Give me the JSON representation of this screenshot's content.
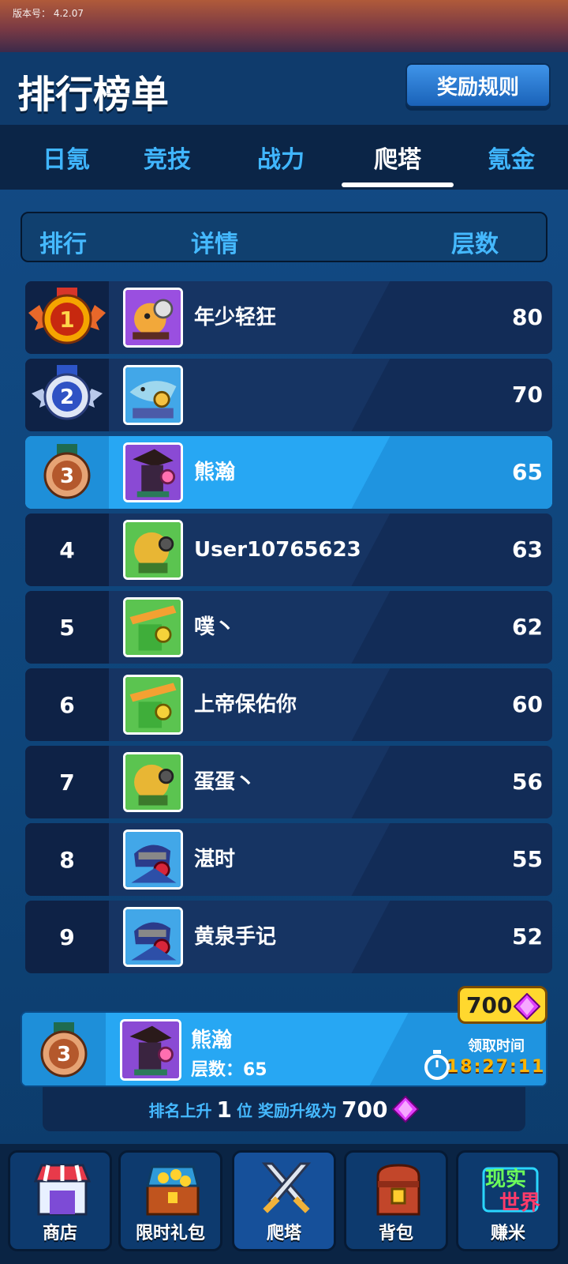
{
  "version": {
    "label": "版本号：",
    "value": "4.2.07"
  },
  "header": {
    "title": "排行榜单",
    "rules_button": "奖励规则"
  },
  "tabs": [
    {
      "label": "日氪"
    },
    {
      "label": "竞技"
    },
    {
      "label": "战力"
    },
    {
      "label": "爬塔",
      "active": true
    },
    {
      "label": "氪金"
    }
  ],
  "columns": {
    "rank": "排行",
    "detail": "详情",
    "floors": "层数"
  },
  "rows": [
    {
      "rank": "1",
      "name": "年少轻狂",
      "score": "80"
    },
    {
      "rank": "2",
      "name": "",
      "score": "70"
    },
    {
      "rank": "3",
      "name": "熊瀚",
      "score": "65",
      "highlight": true
    },
    {
      "rank": "4",
      "name": "User10765623",
      "score": "63"
    },
    {
      "rank": "5",
      "name": "噗丶",
      "score": "62"
    },
    {
      "rank": "6",
      "name": "上帝保佑你",
      "score": "60"
    },
    {
      "rank": "7",
      "name": "蛋蛋丶",
      "score": "56"
    },
    {
      "rank": "8",
      "name": "湛时",
      "score": "55"
    },
    {
      "rank": "9",
      "name": "黄泉手记",
      "score": "52"
    }
  ],
  "my_rank": {
    "rank": "3",
    "name": "熊瀚",
    "floors_text": "层数：65",
    "reward_amount": "700",
    "claim_label": "领取时间",
    "countdown": "18:27:11"
  },
  "promo": {
    "prefix": "排名上升",
    "places": "1",
    "mid": "位  奖励升级为",
    "reward": "700"
  },
  "bottom_nav": [
    {
      "label": "商店",
      "icon": "shop-icon"
    },
    {
      "label": "限时礼包",
      "icon": "treasure-chest-icon"
    },
    {
      "label": "爬塔",
      "icon": "crossed-swords-icon",
      "active": true
    },
    {
      "label": "背包",
      "icon": "backpack-icon"
    },
    {
      "label": "赚米",
      "icon": "real-world-logo-icon",
      "logo_text": [
        "现实",
        "世界"
      ]
    }
  ],
  "colors": {
    "accent_blue": "#45b9ff",
    "highlight_row": "#27a7f3",
    "gold": "#ffd82e",
    "gem": "#e040fb",
    "timer": "#ffb400"
  }
}
